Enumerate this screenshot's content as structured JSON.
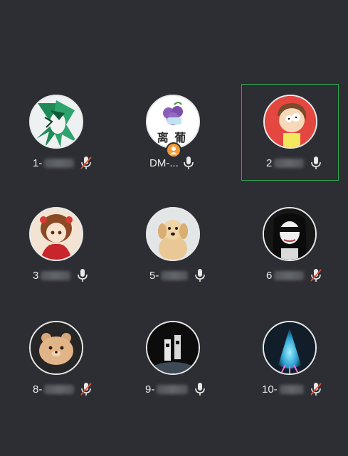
{
  "participants": [
    {
      "label": "1-",
      "muted": true,
      "avatar": "green-haired-anime-avatar"
    },
    {
      "label": "DM-...",
      "muted": false,
      "host": true,
      "avatar_text": "离 葡",
      "avatar": "grape-mask-avatar"
    },
    {
      "label": "2",
      "muted": false,
      "active": true,
      "avatar": "cartoon-boy-avatar"
    },
    {
      "label": "3",
      "muted": false,
      "avatar": "red-dress-girl-avatar"
    },
    {
      "label": "5-",
      "muted": false,
      "avatar": "golden-puppy-avatar"
    },
    {
      "label": "6",
      "muted": true,
      "avatar": "masked-girl-avatar"
    },
    {
      "label": "8-",
      "muted": true,
      "avatar": "bear-avatar"
    },
    {
      "label": "9-",
      "muted": false,
      "avatar": "dark-figure-avatar"
    },
    {
      "label": "10-",
      "muted": true,
      "avatar": "glow-fish-avatar"
    }
  ],
  "colors": {
    "background": "#2c2e33",
    "active_border": "#2fa84f",
    "muted_slash": "#e0553a",
    "host_badge": "#f29c38"
  }
}
